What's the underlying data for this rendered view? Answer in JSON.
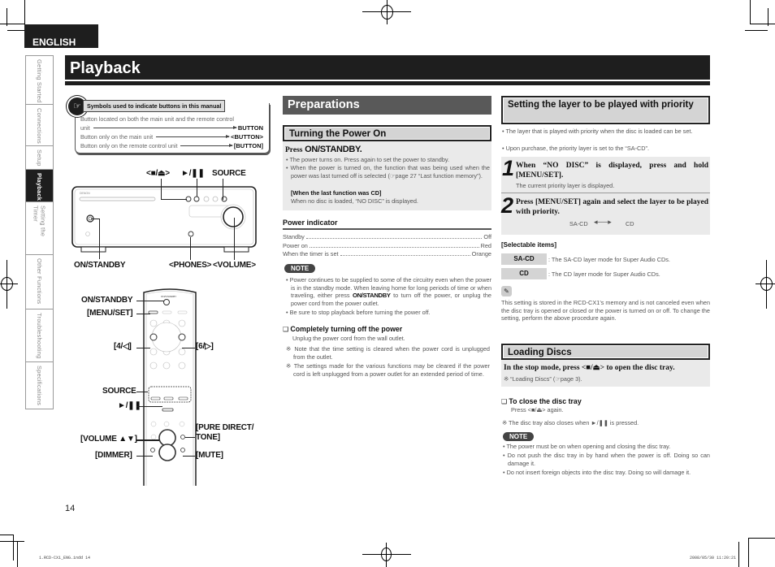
{
  "language_tab": "ENGLISH",
  "sidenav": {
    "items": [
      {
        "label": "Getting Started",
        "active": false
      },
      {
        "label": "Connections",
        "active": false
      },
      {
        "label": "Setup",
        "active": false
      },
      {
        "label": "Playback",
        "active": true
      },
      {
        "label": "Setting the Timer",
        "active": false
      },
      {
        "label": "Other Functions",
        "active": false
      },
      {
        "label": "Troubleshooting",
        "active": false
      },
      {
        "label": "Specifications",
        "active": false
      }
    ]
  },
  "page_title": "Playback",
  "symbols_legend": {
    "title": "Symbols used to indicate buttons in this manual",
    "icon": "pointing-hand-icon",
    "rows": [
      {
        "text_line1": "Button located on both the main unit and the remote control",
        "text": "unit",
        "symbol": "BUTTON"
      },
      {
        "text": "Button only on the main unit",
        "symbol": "<BUTTON>"
      },
      {
        "text": "Button only on the remote control unit",
        "symbol": "[BUTTON]"
      }
    ]
  },
  "main_unit_diagram": {
    "brand": "DENON",
    "callouts": {
      "stop_eject": "<■/⏏>",
      "play_pause": "►/❚❚",
      "source": "SOURCE",
      "on_standby": "ON/STANDBY",
      "phones": "<PHONES>",
      "volume": "<VOLUME>"
    }
  },
  "remote_diagram": {
    "callouts": {
      "on_standby": "ON/STANDBY",
      "menu_set": "[MENU/SET]",
      "left": "[4/◁]",
      "right": "[6/▷]",
      "source": "SOURCE",
      "play_pause": "►/❚❚",
      "pure_direct_tone": "[PURE DIRECT/ TONE]",
      "volume": "[VOLUME ▲▼]",
      "dimmer": "[DIMMER]",
      "mute": "[MUTE]"
    }
  },
  "preparations": {
    "heading": "Preparations",
    "turning_power_on": {
      "heading": "Turning the Power On",
      "press_prefix": "Press",
      "press_button": "ON/STANDBY.",
      "bullets": [
        "The power turns on. Press again to set the power to standby.",
        "When the power is turned on, the function that was being used when the power was last turned off is selected (☞page 27 “Last function memory”)."
      ],
      "sub_label": "[When the last function was CD]",
      "sub_text": "When no disc is loaded, “NO DISC” is displayed."
    },
    "power_indicator": {
      "heading": "Power indicator",
      "rows": [
        {
          "state": "Standby",
          "color": "Off"
        },
        {
          "state": "Power on",
          "color": "Red"
        },
        {
          "state": "When the timer is set",
          "color": "Orange"
        }
      ]
    },
    "note": {
      "label": "NOTE",
      "bullets": [
        {
          "before": "Power continues to be supplied to some of the circuitry even when the power is in the standby mode. When leaving home for long periods of time or when traveling, either press ",
          "bold": "ON/STANDBY",
          "after": " to turn off the power, or unplug the power cord from the power outlet."
        },
        {
          "before": "Be sure to stop playback before turning the power off.",
          "bold": "",
          "after": ""
        }
      ]
    },
    "completely_off": {
      "heading": "Completely turning off the power",
      "text": "Unplug the power cord from the wall outlet.",
      "notes": [
        "Note that the time setting is cleared when the power cord is unplugged from the outlet.",
        "The settings made for the various functions may be cleared if the power cord is left unplugged from a power outlet for an extended period of time."
      ]
    }
  },
  "layer_priority": {
    "heading": "Setting the layer to be played with priority",
    "bullets": [
      "The layer that is played with priority when the disc is loaded can be set.",
      "Upon purchase, the priority layer is set to the “SA-CD”."
    ],
    "steps": [
      {
        "number": "1",
        "title": "When “NO DISC” is displayed, press and hold [MENU/SET].",
        "detail": "The current priority layer is displayed."
      },
      {
        "number": "2",
        "title": "Press [MENU/SET] again and select the layer to be played with priority.",
        "cycle_a": "SA-CD",
        "cycle_b": "CD"
      }
    ],
    "selectable_heading": "[Selectable items]",
    "selectable_items": [
      {
        "label": "SA-CD",
        "desc": ": The SA-CD layer mode for Super Audio CDs."
      },
      {
        "label": "CD",
        "desc": ": The CD layer mode for Super Audio CDs."
      }
    ],
    "memo_icon": "pencil-icon",
    "memo_text": "This setting is stored in the RCD-CX1’s memory and is not canceled even when the disc tray is opened or closed or the power is turned on or off. To change the setting, perform the above procedure again."
  },
  "loading_discs": {
    "heading": "Loading Discs",
    "instruction": "In the stop mode, press <■/⏏> to open the disc tray.",
    "reference": "“Loading Discs” (☞page 3).",
    "close_heading": "To close the disc tray",
    "close_text": "Press <■/⏏> again.",
    "close_note": "The disc tray also closes when ►/❚❚ is pressed.",
    "note_label": "NOTE",
    "note_bullets": [
      "The power must be on when opening and closing the disc tray.",
      "Do not push the disc tray in by hand when the power is off. Doing so can damage it.",
      "Do not insert foreign objects into the disc tray. Doing so will damage it."
    ]
  },
  "page_number": "14",
  "footer": {
    "file": "1.RCD-CX1_ENG.indd   14",
    "timestamp": "2008/05/30   11:20:21"
  }
}
